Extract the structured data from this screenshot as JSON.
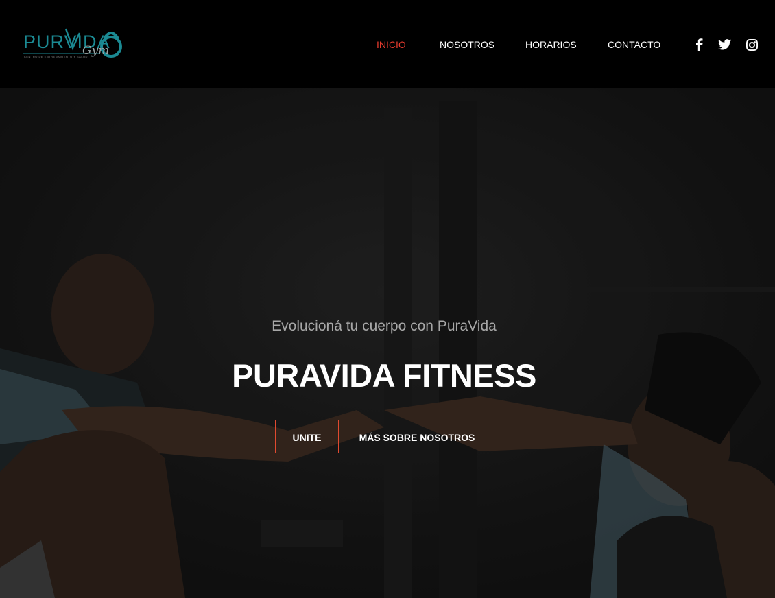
{
  "brand": {
    "name": "PURVIDA",
    "gym": "Gym",
    "tagline": "CENTRO DE ENTRENAMIENTO Y SALUD"
  },
  "nav": {
    "items": [
      {
        "label": "INICIO",
        "active": true
      },
      {
        "label": "NOSOTROS",
        "active": false
      },
      {
        "label": "HORARIOS",
        "active": false
      },
      {
        "label": "CONTACTO",
        "active": false
      }
    ]
  },
  "social": [
    "facebook-icon",
    "twitter-icon",
    "instagram-icon"
  ],
  "hero": {
    "subtitle": "Evolucioná tu cuerpo con PuraVida",
    "title": "PURAVIDA FITNESS",
    "buttons": [
      {
        "label": "UNITE"
      },
      {
        "label": "MÁS SOBRE NOSOTROS"
      }
    ]
  },
  "colors": {
    "accent": "#e63b2e",
    "brand_teal": "#1b8a93",
    "header_bg": "#000000"
  }
}
